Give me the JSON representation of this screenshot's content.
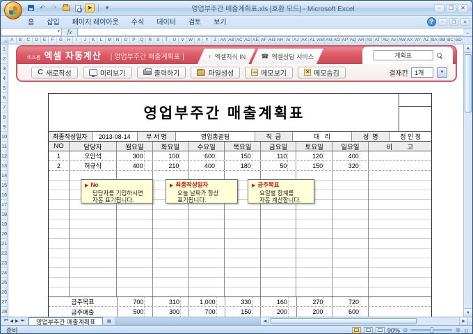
{
  "titlebar": {
    "title": "영업부주간 매출계획표.xls  [호환 모드] - Microsoft Excel",
    "qat_icons": [
      "office-orb",
      "save-icon",
      "undo-icon",
      "redo-icon",
      "open-folder-icon",
      "print-preview-icon",
      "pointer-icon",
      "qat-dropdown-icon"
    ],
    "window_controls": [
      "minimize",
      "restore",
      "close"
    ]
  },
  "ribbon": {
    "tabs": [
      "홈",
      "삽입",
      "페이지 레이아웃",
      "수식",
      "데이터",
      "검토",
      "보기"
    ],
    "help_icon": "help-icon"
  },
  "formula_bar": {
    "name_box": "",
    "fx": "fx",
    "formula": ""
  },
  "grid": {
    "col_letters": [
      "A",
      "B",
      "C",
      "D",
      "E",
      "F",
      "G",
      "H",
      "I",
      "J",
      "K",
      "L",
      "M",
      "N",
      "O",
      "P",
      "Q",
      "R",
      "S",
      "T",
      "U",
      "V",
      "W",
      "X",
      "Y",
      "Z",
      "AA",
      "AB",
      "AC",
      "AD",
      "AE",
      "AF",
      "AG",
      "AH",
      "AI",
      "AJ",
      "AK",
      "AL",
      "AM",
      "AN",
      "AO",
      "AP",
      "AQ",
      "AR",
      "AS",
      "AT",
      "AU",
      "AV",
      "AW",
      "AX",
      "AY",
      "AZ",
      "BA",
      "BB",
      "BC",
      "BD"
    ],
    "row_count": 28
  },
  "addin": {
    "brand_prefix": "비즈폼",
    "brand": "엑셀 자동계산",
    "doc_title": "[ 영업부주간 매출계획표 ]",
    "tabs": [
      {
        "icon": "knowledge-pin-icon",
        "glyph": "♀",
        "label": "엑셀지식 IN"
      },
      {
        "icon": "phone-icon",
        "glyph": "☎",
        "label": "엑셀상담 서비스"
      }
    ],
    "search": {
      "value": "계획표",
      "icon": "search-icon"
    },
    "buttons": [
      {
        "icon": "refresh-icon",
        "label": "새로작성"
      },
      {
        "icon": "monitor-icon",
        "label": "미리보기"
      },
      {
        "icon": "printer-icon",
        "label": "출력하기"
      },
      {
        "icon": "file-create-icon",
        "label": "파일생성"
      },
      {
        "icon": "memo-show-icon",
        "label": "메모보기"
      },
      {
        "icon": "memo-hide-icon",
        "label": "메모숨김"
      }
    ],
    "approval": {
      "label": "결재칸",
      "value": "1개"
    }
  },
  "worksheet": {
    "title": "영업부주간 매출계획표",
    "info_row": [
      {
        "label": "최종작성일자",
        "value": "2013-08-14"
      },
      {
        "label": "부 서 명",
        "value": "영업총괄팀"
      },
      {
        "label": "직  급",
        "value": "대   리"
      },
      {
        "label": "성  명",
        "value": "정 인 정"
      }
    ],
    "columns": [
      "NO",
      "담당자",
      "월요일",
      "화요일",
      "수요일",
      "목요일",
      "금요일",
      "토요일",
      "일요일",
      "비        고"
    ],
    "data_rows": [
      {
        "no": "1",
        "name": "오안석",
        "values": [
          "300",
          "100",
          "600",
          "150",
          "110",
          "120",
          "400"
        ],
        "note": ""
      },
      {
        "no": "2",
        "name": "허규식",
        "values": [
          "400",
          "210",
          "400",
          "180",
          "50",
          "150",
          "320"
        ],
        "note": ""
      }
    ],
    "summary_rows": [
      {
        "label": "금주목표",
        "values": [
          "700",
          "310",
          "1,000",
          "330",
          "160",
          "270",
          "720"
        ],
        "note": ""
      },
      {
        "label": "금주매출",
        "values": [
          "500",
          "300",
          "700",
          "150",
          "200",
          "200",
          "600"
        ],
        "note": ""
      }
    ],
    "comments": [
      {
        "title": "No",
        "lines": [
          "담당자를 기입하시면",
          "자동 표기됩니다."
        ]
      },
      {
        "title": "최종작성일자",
        "lines": [
          "오늘 날짜가 항상",
          "표기됩니다."
        ]
      },
      {
        "title": "금주목표",
        "lines": [
          "요일별 합계를",
          "자동 계산합니다."
        ]
      }
    ]
  },
  "tabbar": {
    "sheet_name": "영업부주간 매출계획표"
  },
  "statusbar": {
    "ready": "준비",
    "zoom_level": "90%"
  },
  "colors": {
    "banner_red": "#d9545f",
    "comment_bg": "#ffffd8",
    "header_gray": "#ececec",
    "accent_blue": "#2f6fc1"
  }
}
